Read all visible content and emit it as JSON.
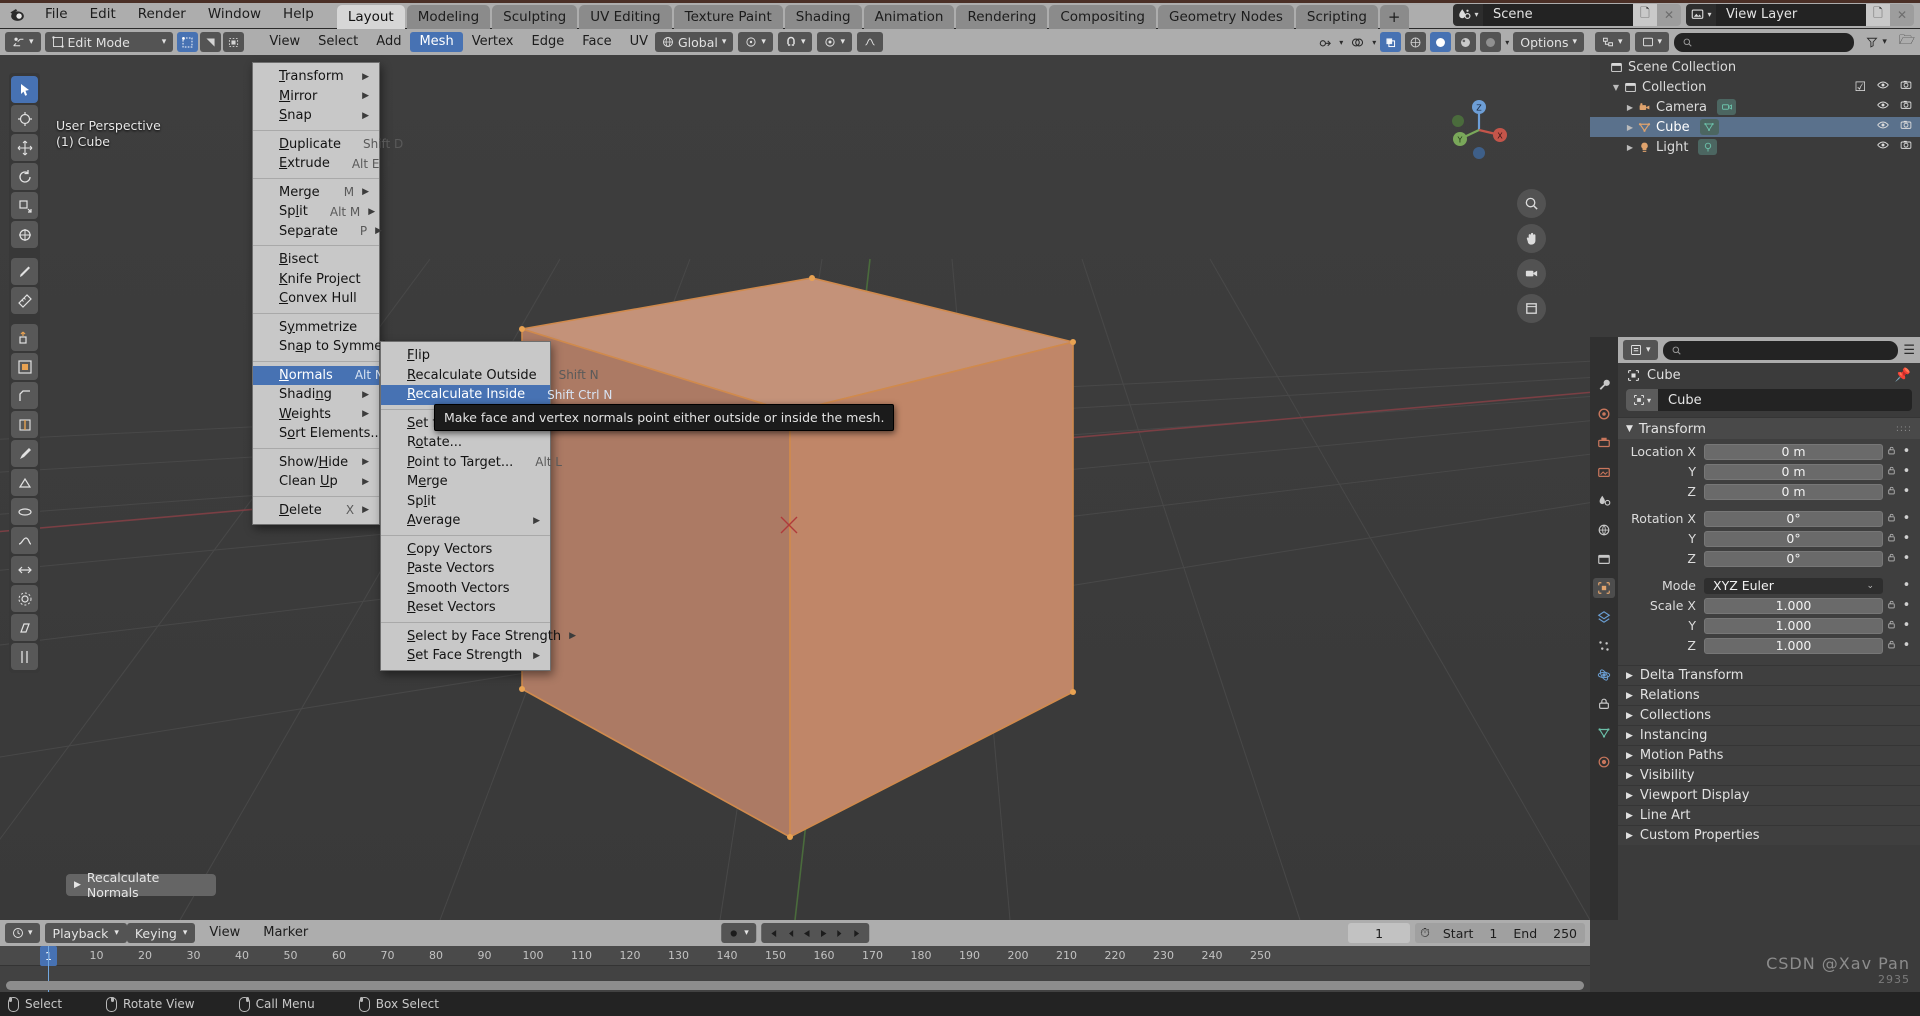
{
  "topbar": {
    "logo_icon": "blender-logo-icon",
    "menus": [
      "File",
      "Edit",
      "Render",
      "Window",
      "Help"
    ],
    "workspace_tabs": [
      {
        "label": "Layout",
        "active": true
      },
      {
        "label": "Modeling",
        "active": false
      },
      {
        "label": "Sculpting",
        "active": false
      },
      {
        "label": "UV Editing",
        "active": false
      },
      {
        "label": "Texture Paint",
        "active": false
      },
      {
        "label": "Shading",
        "active": false
      },
      {
        "label": "Animation",
        "active": false
      },
      {
        "label": "Rendering",
        "active": false
      },
      {
        "label": "Compositing",
        "active": false
      },
      {
        "label": "Geometry Nodes",
        "active": false
      },
      {
        "label": "Scripting",
        "active": false
      }
    ],
    "add_tab_label": "+",
    "scene": {
      "icon": "scene-icon",
      "name": "Scene",
      "new_icon": "copy-icon",
      "unlink_icon": "x-icon"
    },
    "view_layer": {
      "icon": "view-layer-icon",
      "name": "View Layer",
      "new_icon": "copy-icon",
      "unlink_icon": "x-icon"
    }
  },
  "viewport_header": {
    "mode": "Edit Mode",
    "mode_icon": "edit-mode-icon",
    "select_mode_icons": [
      "vertex-select-icon",
      "edge-select-icon",
      "face-select-icon"
    ],
    "menus": [
      "View",
      "Select",
      "Add",
      "Mesh",
      "Vertex",
      "Edge",
      "Face",
      "UV"
    ],
    "active_menu": "Mesh",
    "transform_orientation": "Global",
    "snap_icon": "magnet-icon",
    "proportional_icon": "proportional-edit-icon",
    "falloff_icon": "smooth-falloff-icon",
    "options_label": "Options",
    "shading_icons": [
      "wireframe-icon",
      "solid-icon",
      "material-preview-icon",
      "rendered-icon"
    ],
    "overlay_icons": [
      "show-gizmo-icon",
      "overlays-icon",
      "xray-icon"
    ]
  },
  "viewport": {
    "info_lines": [
      "User Perspective",
      "(1) Cube"
    ],
    "operator_panel": {
      "label": "Recalculate Normals",
      "tri": "▶"
    },
    "gizmo_axes": [
      "X",
      "Y",
      "Z"
    ],
    "nav_buttons": [
      "zoom-icon",
      "pan-hand-icon",
      "camera-view-icon",
      "toggle-ortho-icon"
    ]
  },
  "mesh_menu": {
    "items": [
      {
        "label": "Transform",
        "under": 0,
        "shortcut": "",
        "arrow": true
      },
      {
        "label": "Mirror",
        "under": 0,
        "shortcut": "",
        "arrow": true
      },
      {
        "label": "Snap",
        "under": 0,
        "shortcut": "",
        "arrow": true
      },
      {
        "sep": true
      },
      {
        "label": "Duplicate",
        "under": 0,
        "shortcut": "Shift D",
        "arrow": false
      },
      {
        "label": "Extrude",
        "under": 0,
        "shortcut": "Alt E",
        "arrow": true
      },
      {
        "sep": true
      },
      {
        "label": "Merge",
        "under": 3,
        "shortcut": "M",
        "arrow": true
      },
      {
        "label": "Split",
        "under": 2,
        "shortcut": "Alt M",
        "arrow": true
      },
      {
        "label": "Separate",
        "under": 3,
        "shortcut": "P",
        "arrow": true
      },
      {
        "sep": true
      },
      {
        "label": "Bisect",
        "under": 0,
        "shortcut": "",
        "arrow": false
      },
      {
        "label": "Knife Project",
        "under": 0,
        "shortcut": "",
        "arrow": false
      },
      {
        "label": "Convex Hull",
        "under": 0,
        "shortcut": "",
        "arrow": false
      },
      {
        "sep": true
      },
      {
        "label": "Symmetrize",
        "under": 1,
        "shortcut": "",
        "arrow": false
      },
      {
        "label": "Snap to Symmetry",
        "under": 2,
        "shortcut": "",
        "arrow": false
      },
      {
        "sep": true
      },
      {
        "label": "Normals",
        "under": 0,
        "shortcut": "Alt N",
        "arrow": true,
        "highlight": true
      },
      {
        "label": "Shading",
        "under": 5,
        "shortcut": "",
        "arrow": true
      },
      {
        "label": "Weights",
        "under": 0,
        "shortcut": "",
        "arrow": true
      },
      {
        "label": "Sort Elements...",
        "under": 1,
        "shortcut": "",
        "arrow": true
      },
      {
        "sep": true
      },
      {
        "label": "Show/Hide",
        "under": 5,
        "shortcut": "",
        "arrow": true
      },
      {
        "label": "Clean Up",
        "under": 6,
        "shortcut": "",
        "arrow": true
      },
      {
        "sep": true
      },
      {
        "label": "Delete",
        "under": 0,
        "shortcut": "X",
        "arrow": true
      }
    ]
  },
  "normals_submenu": {
    "items": [
      {
        "label": "Flip",
        "under": 0,
        "shortcut": "",
        "arrow": false
      },
      {
        "label": "Recalculate Outside",
        "under": 0,
        "shortcut": "Shift N",
        "arrow": false
      },
      {
        "label": "Recalculate Inside",
        "under": 0,
        "shortcut": "Shift Ctrl N",
        "arrow": false,
        "highlight": true
      },
      {
        "sep": true
      },
      {
        "label": "Set from Faces",
        "under": 0,
        "shortcut": "",
        "arrow": false
      },
      {
        "label": "Rotate...",
        "under": 1,
        "shortcut": "",
        "arrow": false
      },
      {
        "label": "Point to Target...",
        "under": 0,
        "shortcut": "Alt L",
        "arrow": false
      },
      {
        "label": "Merge",
        "under": 1,
        "shortcut": "",
        "arrow": false
      },
      {
        "label": "Split",
        "under": 2,
        "shortcut": "",
        "arrow": false
      },
      {
        "label": "Average",
        "under": 0,
        "shortcut": "",
        "arrow": true
      },
      {
        "sep": true
      },
      {
        "label": "Copy Vectors",
        "under": 0,
        "shortcut": "",
        "arrow": false
      },
      {
        "label": "Paste Vectors",
        "under": 0,
        "shortcut": "",
        "arrow": false
      },
      {
        "label": "Smooth Vectors",
        "under": 0,
        "shortcut": "",
        "arrow": false
      },
      {
        "label": "Reset Vectors",
        "under": 0,
        "shortcut": "",
        "arrow": false
      },
      {
        "sep": true
      },
      {
        "label": "Select by Face Strength",
        "under": 0,
        "shortcut": "",
        "arrow": true
      },
      {
        "label": "Set Face Strength",
        "under": 0,
        "shortcut": "",
        "arrow": true
      }
    ]
  },
  "tooltip": {
    "text": "Make face and vertex normals point either outside or inside the mesh."
  },
  "outliner": {
    "search_placeholder": "",
    "filter_icon": "filter-icon",
    "rows": [
      {
        "label": "Scene Collection",
        "icon": "collection-icon",
        "indent": 0,
        "tri": "",
        "selected": false,
        "checkbox": false,
        "eye": false,
        "camera": false
      },
      {
        "label": "Collection",
        "icon": "collection-icon",
        "indent": 1,
        "tri": "▼",
        "selected": false,
        "checkbox": true,
        "eye": true,
        "camera": true
      },
      {
        "label": "Camera",
        "icon": "camera-icon",
        "indent": 2,
        "tri": "▶",
        "selected": false,
        "checkbox": false,
        "eye": true,
        "camera": true,
        "chip": "camera-data-icon"
      },
      {
        "label": "Cube",
        "icon": "mesh-icon",
        "indent": 2,
        "tri": "▶",
        "selected": true,
        "checkbox": false,
        "eye": true,
        "camera": true,
        "chip": "mesh-data-icon"
      },
      {
        "label": "Light",
        "icon": "light-icon",
        "indent": 2,
        "tri": "▶",
        "selected": false,
        "checkbox": false,
        "eye": true,
        "camera": true,
        "chip": "light-data-icon"
      }
    ]
  },
  "properties": {
    "search_placeholder": "",
    "tabs": [
      "tool-icon",
      "render-icon",
      "output-icon",
      "view-layer-icon",
      "scene-icon",
      "world-icon",
      "collection-icon",
      "object-icon",
      "modifiers-icon",
      "particles-icon",
      "physics-icon",
      "constraints-icon",
      "object-data-icon",
      "material-icon"
    ],
    "active_tab_index": 7,
    "breadcrumb": {
      "icon": "object-icon",
      "label": "Cube",
      "pin_icon": "pin-icon"
    },
    "id_field": {
      "icon": "object-icon",
      "value": "Cube"
    },
    "transform": {
      "title": "Transform",
      "grip_icon": "grip-dots-icon",
      "rows": [
        {
          "label": "Location X",
          "value": "0 m",
          "lock": true
        },
        {
          "label": "Y",
          "value": "0 m",
          "lock": true
        },
        {
          "label": "Z",
          "value": "0 m",
          "lock": true
        },
        {
          "gap": true
        },
        {
          "label": "Rotation X",
          "value": "0°",
          "lock": true
        },
        {
          "label": "Y",
          "value": "0°",
          "lock": true
        },
        {
          "label": "Z",
          "value": "0°",
          "lock": true
        },
        {
          "gap": true
        },
        {
          "label": "Mode",
          "value": "XYZ Euler",
          "dropdown": true
        },
        {
          "label": "Scale X",
          "value": "1.000",
          "lock": true
        },
        {
          "label": "Y",
          "value": "1.000",
          "lock": true
        },
        {
          "label": "Z",
          "value": "1.000",
          "lock": true
        }
      ]
    },
    "collapsed_panels": [
      "Delta Transform",
      "Relations",
      "Collections",
      "Instancing",
      "Motion Paths",
      "Visibility",
      "Viewport Display",
      "Line Art",
      "Custom Properties"
    ]
  },
  "timeline": {
    "editor_icon": "timeline-icon",
    "playback_label": "Playback",
    "keying_label": "Keying",
    "menus": [
      "View",
      "Marker"
    ],
    "record_icon": "record-icon",
    "transport_icons": [
      "jump-start-icon",
      "prev-keyframe-icon",
      "play-reverse-icon",
      "play-icon",
      "next-keyframe-icon",
      "jump-end-icon"
    ],
    "current_frame": "1",
    "frame_icon": "stopwatch-icon",
    "start_label": "Start",
    "start_value": "1",
    "end_label": "End",
    "end_value": "250",
    "ticks": [
      "10",
      "20",
      "30",
      "40",
      "50",
      "60",
      "70",
      "80",
      "90",
      "100",
      "110",
      "120",
      "130",
      "140",
      "150",
      "160",
      "170",
      "180",
      "190",
      "200",
      "210",
      "220",
      "230",
      "240",
      "250"
    ],
    "playhead_label": "1"
  },
  "status_bar": {
    "items": [
      {
        "mouse": "left",
        "label": "Select"
      },
      {
        "mouse": "middle",
        "label": "Rotate View"
      },
      {
        "mouse": "right",
        "label": "Call Menu"
      },
      {
        "mouse": "left",
        "label": "Box Select"
      }
    ],
    "right_text": ""
  },
  "watermark": {
    "text": "CSDN @Xav Pan",
    "sub": "2935"
  },
  "colors": {
    "accent_blue": "#4772b3",
    "header_gray": "#adadad",
    "menu_bg": "#c8c8c8",
    "panel_bg": "#3b3b3b",
    "cube_orange": "#c08668",
    "select_orange": "#e8a252"
  }
}
